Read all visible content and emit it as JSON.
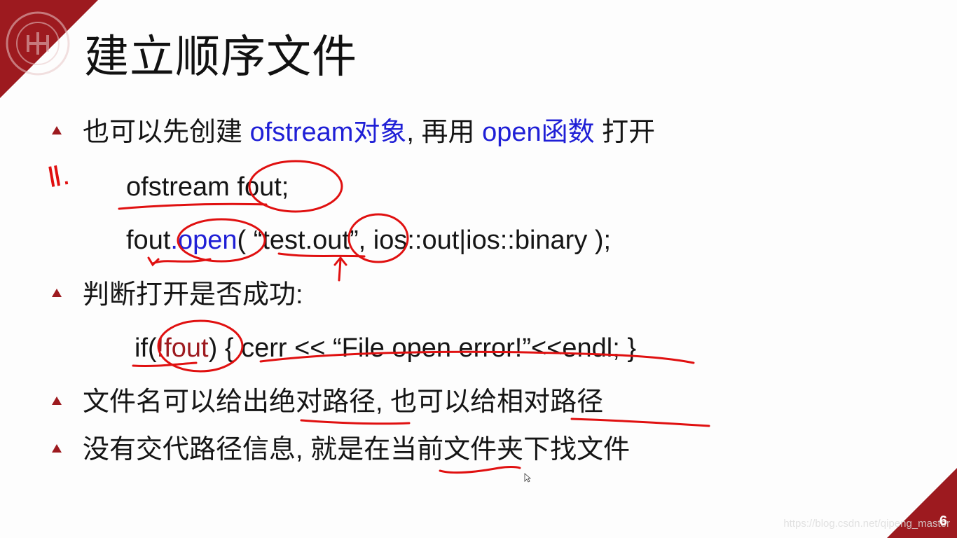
{
  "slide": {
    "title": "建立顺序文件",
    "page_number": "6",
    "watermark": "https://blog.csdn.net/qipeng_master",
    "bullets": [
      {
        "part1": "也可以先创建 ",
        "part2": "ofstream对象",
        "part3": ", 再用 ",
        "part4": "open函数",
        "part5": " 打开"
      },
      {
        "text": "判断打开是否成功:"
      },
      {
        "text": "文件名可以给出绝对路径, 也可以给相对路径"
      },
      {
        "text": "没有交代路径信息, 就是在当前文件夹下找文件"
      }
    ],
    "code": {
      "line1": "ofstream fout;",
      "line2_a": "fout",
      "line2_b": ".open",
      "line2_c": "( “test.out”, ios::out|ios::binary );",
      "line3_a": "if(",
      "line3_b": "!fout",
      "line3_c": ") {  cerr << “File open error!”<<endl;  }"
    },
    "annotation": "Ⅱ."
  },
  "colors": {
    "accent": "#9d1a1f",
    "highlight": "#1f1fd6",
    "ink": "#e01010"
  }
}
